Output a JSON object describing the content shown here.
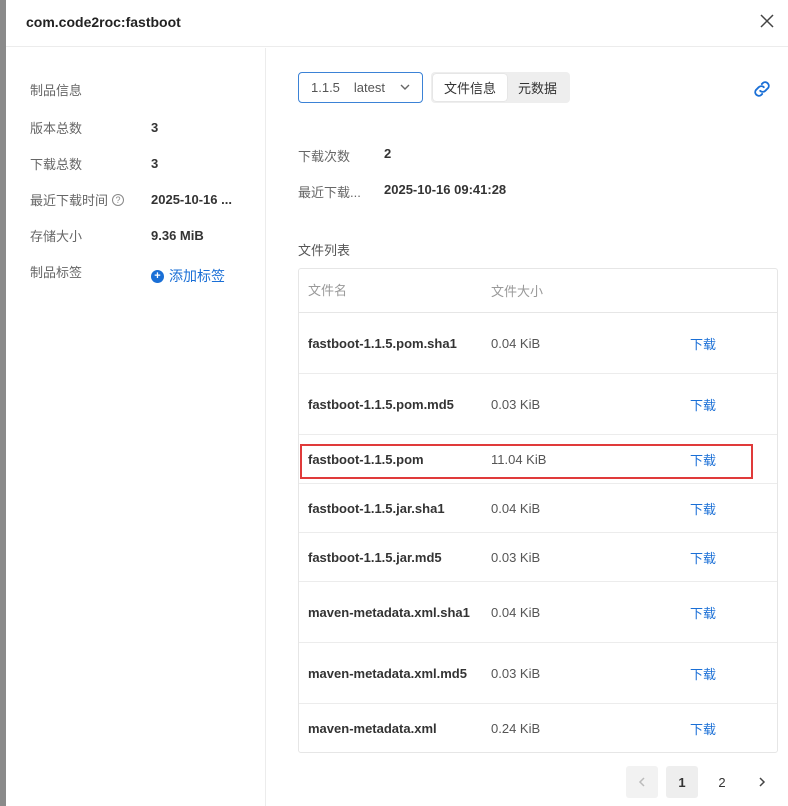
{
  "window": {
    "title": "com.code2roc:fastboot"
  },
  "sidebar": {
    "heading": "制品信息",
    "rows": [
      {
        "label": "版本总数",
        "value": "3"
      },
      {
        "label": "下载总数",
        "value": "3"
      },
      {
        "label": "最近下载时间",
        "value": "2025-10-16 ...",
        "help_icon": "?"
      },
      {
        "label": "存储大小",
        "value": "9.36 MiB"
      }
    ],
    "tags_label": "制品标签",
    "add_tag_label": "添加标签",
    "add_tag_icon": "plus-circle-icon"
  },
  "main": {
    "version": {
      "number": "1.1.5",
      "tag": "latest"
    },
    "tabs": [
      {
        "label": "文件信息",
        "active": true
      },
      {
        "label": "元数据",
        "active": false
      }
    ],
    "link_icon": "link-icon",
    "meta": [
      {
        "label": "下载次数",
        "value": "2"
      },
      {
        "label": "最近下载...",
        "value": "2025-10-16 09:41:28"
      }
    ],
    "file_list_title": "文件列表",
    "table": {
      "columns": [
        "文件名",
        "文件大小"
      ],
      "action_label": "下载",
      "rows": [
        {
          "name": "fastboot-1.1.5.pom.sha1",
          "size": "0.04 KiB"
        },
        {
          "name": "fastboot-1.1.5.pom.md5",
          "size": "0.03 KiB"
        },
        {
          "name": "fastboot-1.1.5.pom",
          "size": "11.04 KiB"
        },
        {
          "name": "fastboot-1.1.5.jar.sha1",
          "size": "0.04 KiB"
        },
        {
          "name": "fastboot-1.1.5.jar.md5",
          "size": "0.03 KiB"
        },
        {
          "name": "maven-metadata.xml.sha1",
          "size": "0.04 KiB"
        },
        {
          "name": "maven-metadata.xml.md5",
          "size": "0.03 KiB"
        },
        {
          "name": "maven-metadata.xml",
          "size": "0.24 KiB"
        }
      ]
    }
  },
  "pagination": {
    "pages": [
      "1",
      "2"
    ],
    "current": "1"
  },
  "colors": {
    "accent": "#1a6fd6",
    "highlight": "#e03a3a"
  }
}
